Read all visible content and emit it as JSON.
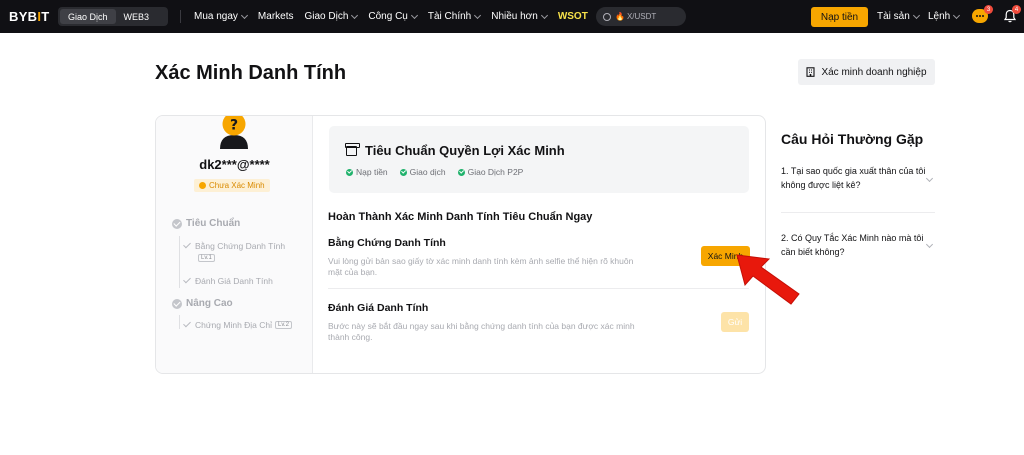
{
  "topbar": {
    "logo_left": "BYB",
    "logo_accent": "I",
    "logo_right": "T",
    "switcher": [
      "Giao Dịch",
      "WEB3"
    ],
    "nav": [
      {
        "label": "Mua ngay",
        "chevron": true
      },
      {
        "label": "Markets",
        "chevron": false
      },
      {
        "label": "Giao Dịch",
        "chevron": true
      },
      {
        "label": "Công Cụ",
        "chevron": true
      },
      {
        "label": "Tài Chính",
        "chevron": true
      },
      {
        "label": "Nhiều hơn",
        "chevron": true
      },
      {
        "label": "WSOT",
        "chevron": false
      }
    ],
    "search_text": "X/USDT",
    "deposit_label": "Nạp tiền",
    "assets_label": "Tài sản",
    "orders_label": "Lệnh",
    "chat_badge": "3",
    "bell_badge": "4"
  },
  "page": {
    "title": "Xác Minh Danh Tính",
    "business_button": "Xác minh doanh nghiệp"
  },
  "profile": {
    "email": "dk2***@****",
    "status": "Chưa Xác Minh"
  },
  "levels": {
    "standard": "Tiêu Chuẩn",
    "standard_items": [
      "Bằng Chứng Danh Tính",
      "Đánh Giá Danh Tính"
    ],
    "standard_tag": "Lv.1",
    "advanced": "Nâng Cao",
    "advanced_items": [
      "Chứng Minh Địa Chỉ"
    ],
    "advanced_tag": "Lv.2"
  },
  "benefits": {
    "title": "Tiêu Chuẩn Quyền Lợi Xác Minh",
    "items": [
      "Nạp tiền",
      "Giao dịch",
      "Giao Dịch P2P"
    ]
  },
  "main": {
    "heading": "Hoàn Thành Xác Minh Danh Tính Tiêu Chuẩn Ngay",
    "proof_title": "Bằng Chứng Danh Tính",
    "proof_desc": "Vui lòng gửi bản sao giấy tờ xác minh danh tính kèm ảnh selfie thể hiện rõ khuôn mặt của bạn.",
    "verify_button": "Xác Minh",
    "review_title": "Đánh Giá Danh Tính",
    "review_desc": "Bước này sẽ bắt đầu ngay sau khi bằng chứng danh tính của bạn được xác minh thành công.",
    "send_button": "Gửi"
  },
  "faq": {
    "title": "Câu Hỏi Thường Gặp",
    "items": [
      "1. Tại sao quốc gia xuất thân của tôi không được liệt kê?",
      "2. Có Quy Tắc Xác Minh nào mà tôi cần biết không?"
    ]
  },
  "colors": {
    "accent": "#f7a600",
    "topbar": "#101014",
    "success": "#20b26c",
    "annotation_arrow": "#e8180c"
  }
}
